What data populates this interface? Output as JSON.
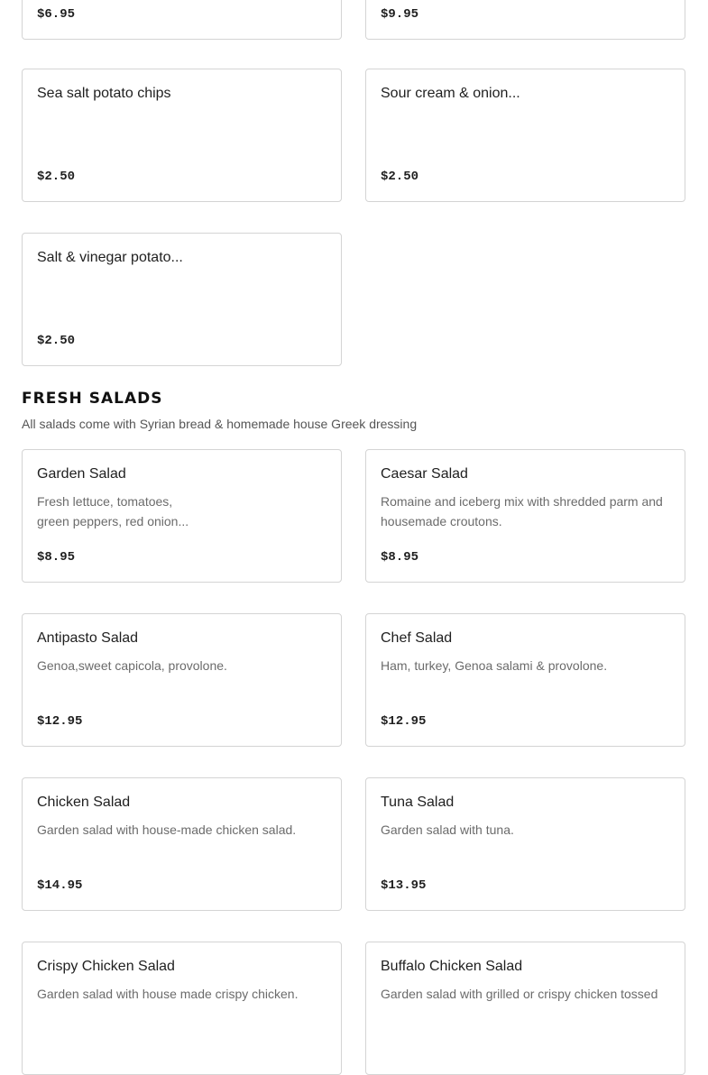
{
  "top_items": [
    {
      "name": "",
      "desc": [],
      "price": "$6.95"
    },
    {
      "name": "",
      "desc": [],
      "price": "$9.95"
    },
    {
      "name": "Sea salt potato chips",
      "desc": [],
      "price": "$2.50"
    },
    {
      "name": "Sour cream & onion...",
      "desc": [],
      "price": "$2.50"
    },
    {
      "name": "Salt & vinegar potato...",
      "desc": [],
      "price": "$2.50"
    }
  ],
  "fresh_salads": {
    "title": "FRESH SALADS",
    "subtitle": "All salads come with Syrian bread & homemade house Greek dressing",
    "items": [
      {
        "name": "Garden Salad",
        "desc": [
          "Fresh lettuce, tomatoes,",
          "green peppers, red onion..."
        ],
        "price": "$8.95"
      },
      {
        "name": "Caesar Salad",
        "desc": [
          "Romaine and iceberg mix with shredded parm and",
          "housemade croutons."
        ],
        "price": "$8.95"
      },
      {
        "name": "Antipasto Salad",
        "desc": [
          "Genoa,sweet capicola, provolone."
        ],
        "price": "$12.95"
      },
      {
        "name": "Chef Salad",
        "desc": [
          "Ham, turkey, Genoa salami & provolone."
        ],
        "price": "$12.95"
      },
      {
        "name": "Chicken Salad",
        "desc": [
          "Garden salad with house-made chicken salad."
        ],
        "price": "$14.95"
      },
      {
        "name": "Tuna Salad",
        "desc": [
          "Garden salad with tuna."
        ],
        "price": "$13.95"
      },
      {
        "name": "Crispy Chicken Salad",
        "desc": [
          "Garden salad with house made crispy chicken."
        ],
        "price": ""
      },
      {
        "name": "Buffalo Chicken Salad",
        "desc": [
          "Garden salad with grilled or crispy chicken tossed"
        ],
        "price": ""
      }
    ]
  }
}
